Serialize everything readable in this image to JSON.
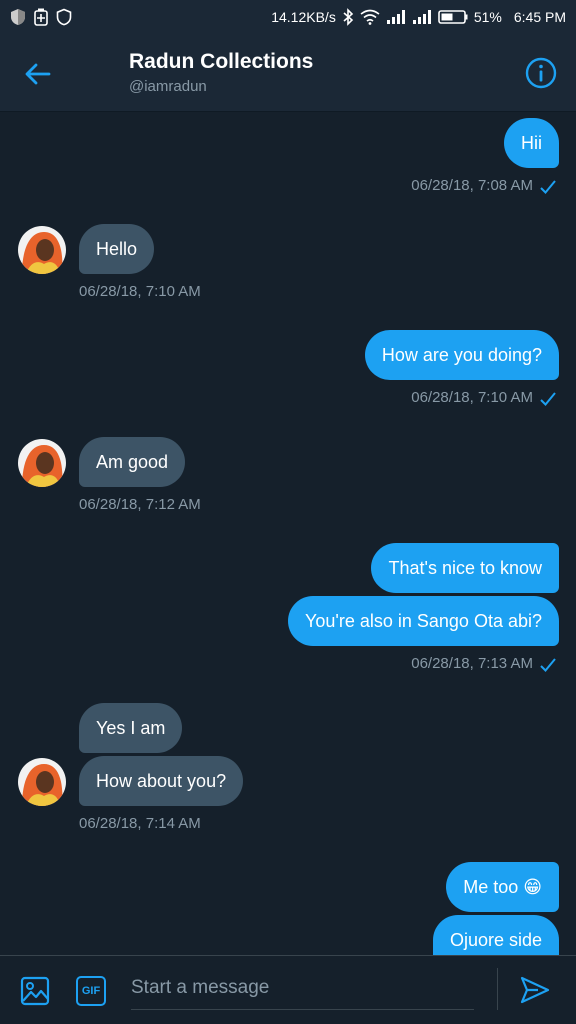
{
  "status": {
    "speed": "14.12KB/s",
    "battery": "51%",
    "time": "6:45 PM"
  },
  "header": {
    "title": "Radun Collections",
    "handle": "@iamradun"
  },
  "messages": [
    {
      "dir": "sent",
      "text": "Hii"
    },
    {
      "dir": "recv",
      "text": "Hello"
    },
    {
      "dir": "sent",
      "text": "How are you doing?"
    },
    {
      "dir": "recv",
      "text": "Am good"
    },
    {
      "dir": "sent",
      "text": "That's nice to know"
    },
    {
      "dir": "sent",
      "text": "You're also in Sango Ota abi?"
    },
    {
      "dir": "recv",
      "text": "Yes I am"
    },
    {
      "dir": "recv",
      "text": "How about you?"
    },
    {
      "dir": "sent",
      "text": "Me too 😁"
    },
    {
      "dir": "sent",
      "text": "Ojuore side"
    }
  ],
  "timestamps": [
    "06/28/18, 7:08 AM",
    "06/28/18, 7:10 AM",
    "06/28/18, 7:10 AM",
    "06/28/18, 7:12 AM",
    "06/28/18, 7:13 AM",
    "06/28/18, 7:14 AM"
  ],
  "composer": {
    "placeholder": "Start a message",
    "gif_label": "GIF"
  },
  "colors": {
    "accent": "#1da1f2",
    "background": "#15202b",
    "received_bubble": "#3d5466",
    "muted_text": "#8899a6"
  },
  "icons": [
    "shield-icon",
    "battery-saver-icon",
    "bluetooth-icon",
    "wifi-icon",
    "signal-icon",
    "battery-icon",
    "back-arrow-icon",
    "info-icon",
    "image-icon",
    "gif-icon",
    "send-icon",
    "check-icon"
  ]
}
